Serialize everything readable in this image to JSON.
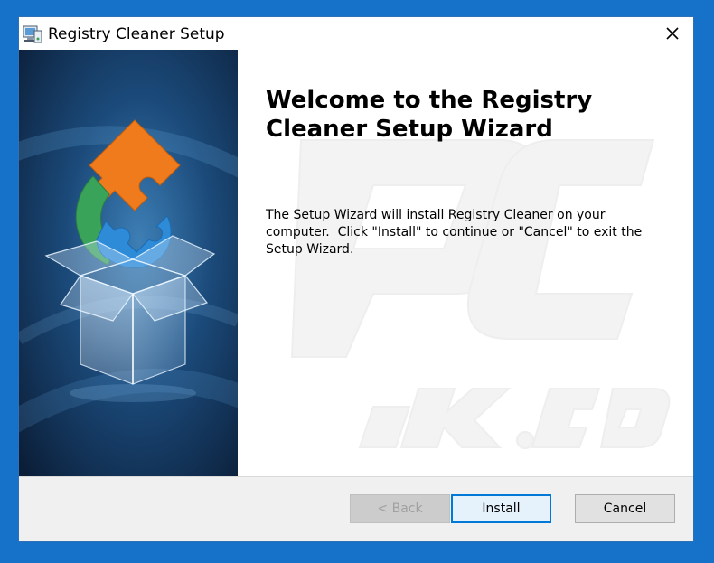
{
  "window": {
    "title": "Registry Cleaner Setup",
    "icon": "installer-computer-icon",
    "close_icon": "close-icon"
  },
  "welcome": {
    "title": "Welcome to the Registry Cleaner Setup Wizard",
    "body": "The Setup Wizard will install Registry Cleaner on your computer.  Click \"Install\" to continue or \"Cancel\" to exit the Setup Wizard."
  },
  "buttons": {
    "back": "< Back",
    "install": "Install",
    "cancel": "Cancel"
  },
  "colors": {
    "desktop": "#1672c9",
    "banner_dark": "#0b1e38",
    "banner_light": "#3d7fb6",
    "puzzle_orange": "#f07b1c",
    "puzzle_green": "#3aa35a",
    "puzzle_blue": "#2d8bd8",
    "accent": "#0078d7"
  }
}
